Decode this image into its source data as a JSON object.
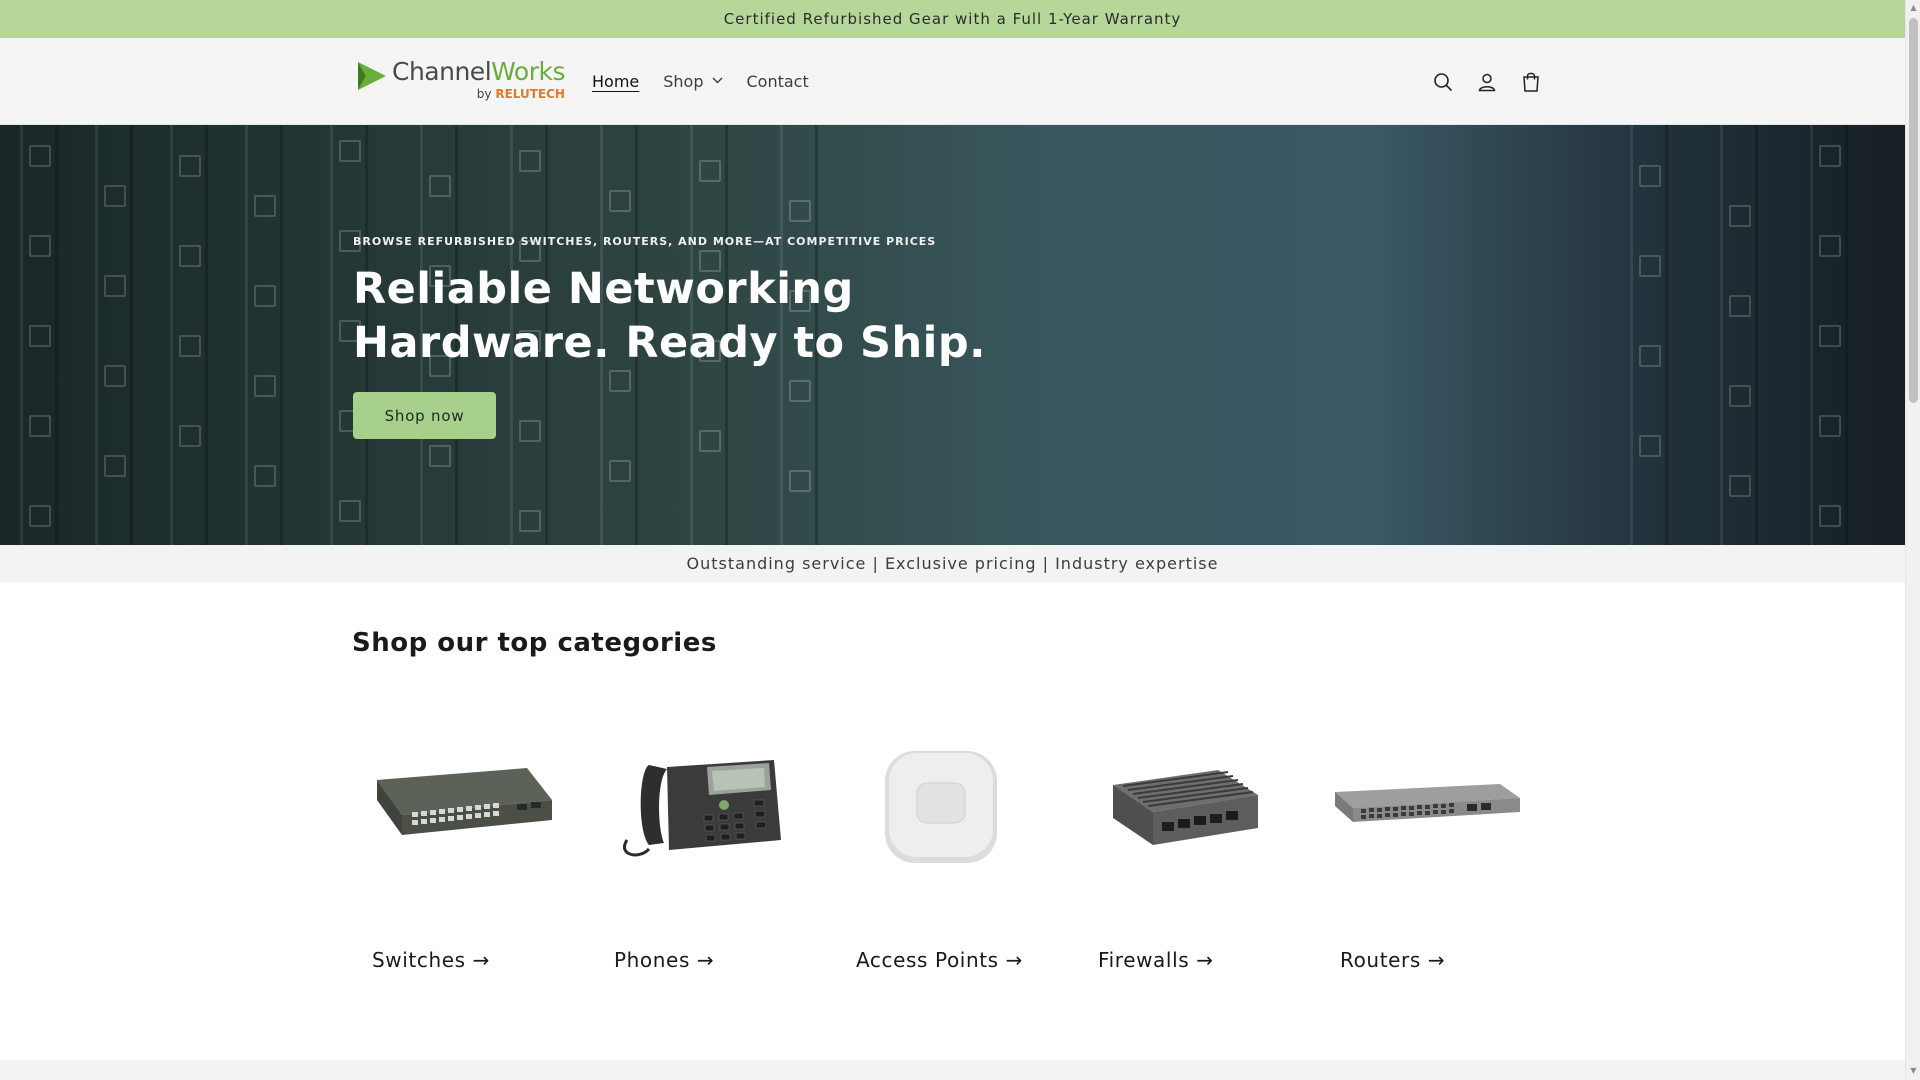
{
  "announcement": {
    "text": "Certified Refurbished Gear with a Full 1-Year Warranty"
  },
  "header": {
    "logo": {
      "main_a": "Channel",
      "main_b": "Works",
      "sub_by": "by",
      "sub_brand": "RELUTECH"
    },
    "nav": [
      {
        "label": "Home",
        "active": true
      },
      {
        "label": "Shop",
        "has_dropdown": true
      },
      {
        "label": "Contact"
      }
    ],
    "icons": [
      "search-icon",
      "account-icon",
      "cart-icon"
    ]
  },
  "hero": {
    "eyebrow": "BROWSE REFURBISHED SWITCHES, ROUTERS, AND MORE—AT COMPETITIVE PRICES",
    "title_line1": "Reliable Networking",
    "title_line2": "Hardware. Ready to Ship.",
    "cta": "Shop now"
  },
  "tagline": "Outstanding service | Exclusive pricing | Industry expertise",
  "categories": {
    "title": "Shop our top categories",
    "items": [
      {
        "label": "Switches →"
      },
      {
        "label": "Phones →"
      },
      {
        "label": "Access Points →"
      },
      {
        "label": "Firewalls →"
      },
      {
        "label": "Routers →"
      }
    ]
  },
  "colors": {
    "accent_green": "#b5d79a",
    "button_green": "#a8d08d",
    "logo_green": "#6aae3a",
    "logo_orange": "#e17a2c"
  }
}
